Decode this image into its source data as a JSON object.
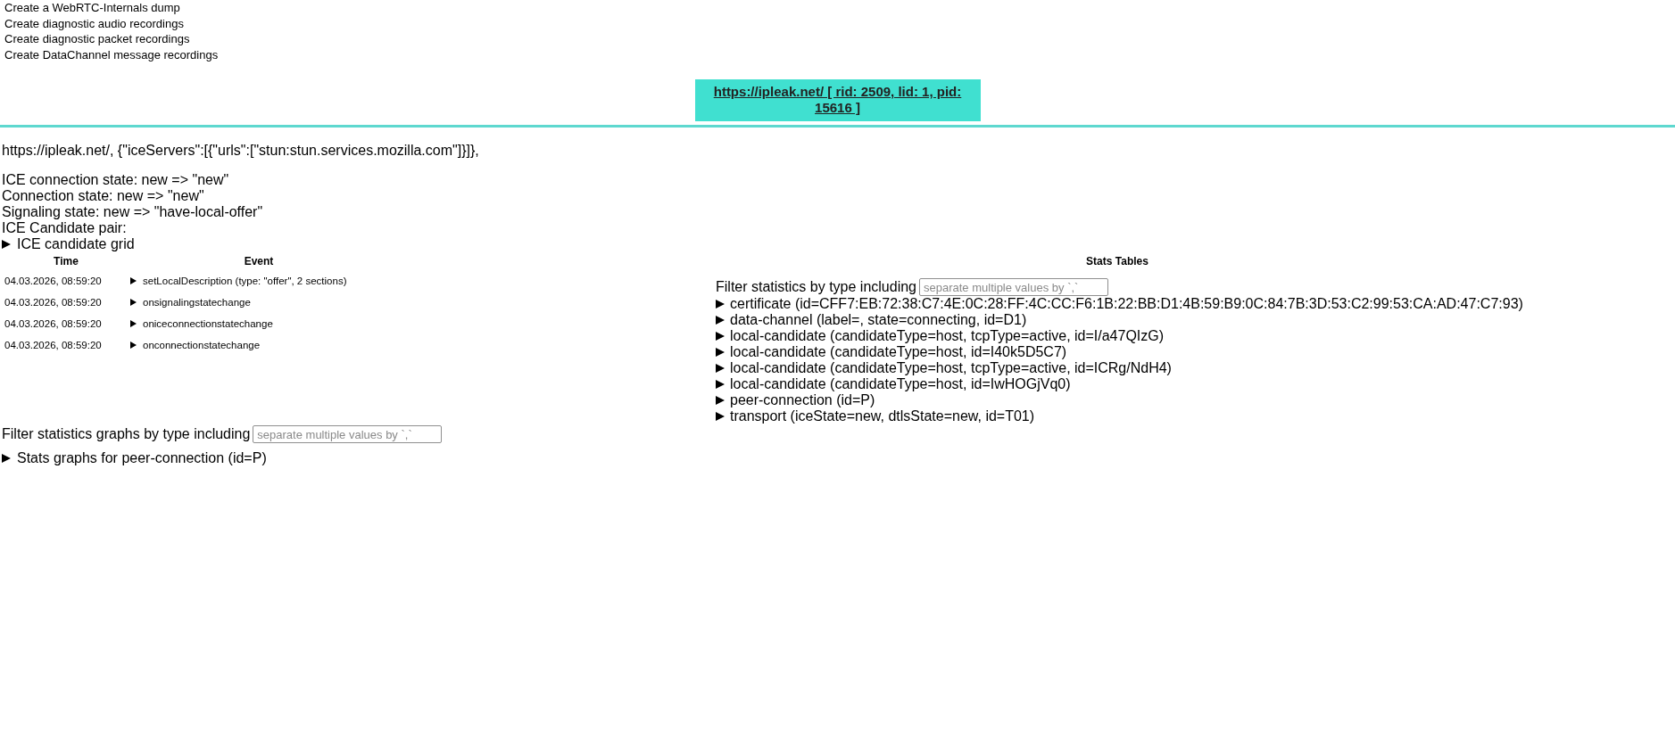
{
  "dump_options": [
    "Create a WebRTC-Internals dump",
    "Create diagnostic audio recordings",
    "Create diagnostic packet recordings",
    "Create DataChannel message recordings"
  ],
  "tabs": [
    {
      "label": "https://ipleak.net/ [ rid: 2509, lid: 1, pid: 15616 ]",
      "selected": true
    }
  ],
  "connection": {
    "config": "https://ipleak.net/, {\"iceServers\":[{\"urls\":[\"stun:stun.services.mozilla.com\"]}]},",
    "states": [
      "ICE connection state: new => \"new\"",
      "Connection state: new => \"new\"",
      "Signaling state: new => \"have-local-offer\"",
      "ICE Candidate pair:"
    ],
    "candidate_grid": {
      "label": "ICE candidate grid",
      "expanded": false
    }
  },
  "event_log": {
    "columns": [
      "Time",
      "Event"
    ],
    "rows": [
      {
        "time": "04.03.2026, 08:59:20",
        "event": "setLocalDescription (type: \"offer\", 2 sections)",
        "expanded": false
      },
      {
        "time": "04.03.2026, 08:59:20",
        "event": "onsignalingstatechange",
        "expanded": false
      },
      {
        "time": "04.03.2026, 08:59:20",
        "event": "oniceconnectionstatechange",
        "expanded": false
      },
      {
        "time": "04.03.2026, 08:59:20",
        "event": "onconnectionstatechange",
        "expanded": false
      }
    ]
  },
  "stats_tables": {
    "title": "Stats Tables",
    "filter": {
      "label": "Filter statistics by type including",
      "placeholder": "separate multiple values by `,`"
    },
    "entries": [
      {
        "label": "certificate (id=CFF7:EB:72:38:C7:4E:0C:28:FF:4C:CC:F6:1B:22:BB:D1:4B:59:B9:0C:84:7B:3D:53:C2:99:53:CA:AD:47:C7:93)",
        "expanded": false
      },
      {
        "label": "data-channel (label=, state=connecting, id=D1)",
        "expanded": false
      },
      {
        "label": "local-candidate (candidateType=host, tcpType=active, id=I/a47QIzG)",
        "expanded": false
      },
      {
        "label": "local-candidate (candidateType=host, id=I40k5D5C7)",
        "expanded": false
      },
      {
        "label": "local-candidate (candidateType=host, tcpType=active, id=ICRg/NdH4)",
        "expanded": false
      },
      {
        "label": "local-candidate (candidateType=host, id=IwHOGjVq0)",
        "expanded": false
      },
      {
        "label": "peer-connection (id=P)",
        "expanded": false
      },
      {
        "label": "transport (iceState=new, dtlsState=new, id=T01)",
        "expanded": false
      }
    ]
  },
  "graphs": {
    "filter": {
      "label": "Filter statistics graphs by type including",
      "placeholder": "separate multiple values by `,`"
    },
    "sections": [
      {
        "label": "Stats graphs for peer-connection (id=P)",
        "expanded": false
      }
    ]
  }
}
